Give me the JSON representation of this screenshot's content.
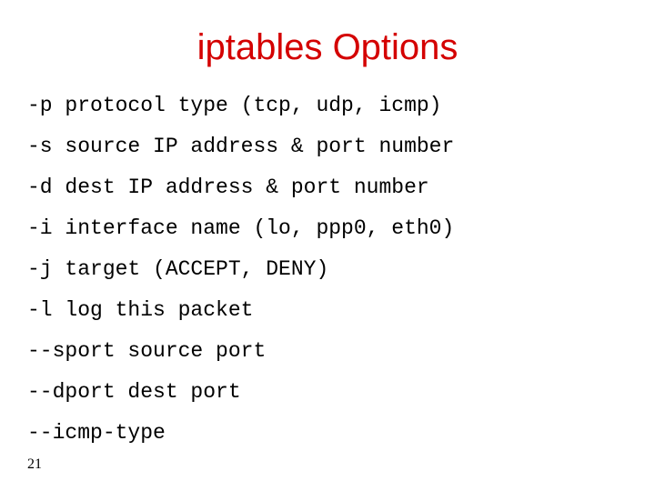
{
  "title": "iptables Options",
  "options": [
    "-p protocol type (tcp, udp, icmp)",
    "-s source IP address & port number",
    "-d dest IP address & port number",
    "-i interface name (lo, ppp0, eth0)",
    "-j target (ACCEPT, DENY)",
    "-l log this packet",
    "--sport source port",
    "--dport dest port",
    "--icmp-type"
  ],
  "page_number": "21"
}
